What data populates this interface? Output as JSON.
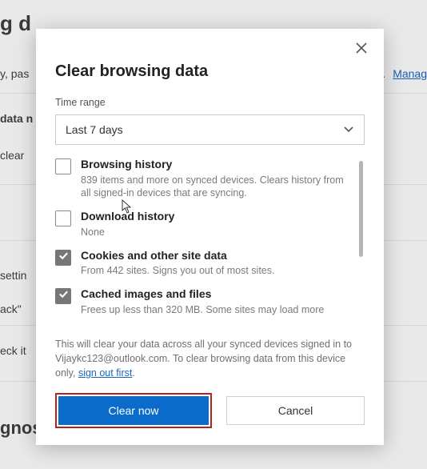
{
  "background": {
    "frag_title_tail": "g d",
    "frag_sub_tail": "y, pas",
    "frag_deleted": "leted.",
    "frag_manage": "Manag",
    "frag_data": "data n",
    "frag_clear": "clear",
    "frag_setting": "settin",
    "frag_ack": "ack\"",
    "frag_eck": "eck it",
    "frag_gno": "gnos"
  },
  "dialog": {
    "title": "Clear browsing data",
    "time_range_label": "Time range",
    "time_range_value": "Last 7 days",
    "options": [
      {
        "title": "Browsing history",
        "sub": "839 items and more on synced devices. Clears history from all signed-in devices that are syncing.",
        "checked": false
      },
      {
        "title": "Download history",
        "sub": "None",
        "checked": false
      },
      {
        "title": "Cookies and other site data",
        "sub": "From 442 sites. Signs you out of most sites.",
        "checked": true
      },
      {
        "title": "Cached images and files",
        "sub": "Frees up less than 320 MB. Some sites may load more",
        "checked": true
      }
    ],
    "notice_pre": "This will clear your data across all your synced devices signed in to Vijaykc123@outlook.com. To clear browsing data from this device only, ",
    "notice_link": "sign out first",
    "notice_post": ".",
    "primary_label": "Clear now",
    "secondary_label": "Cancel"
  }
}
